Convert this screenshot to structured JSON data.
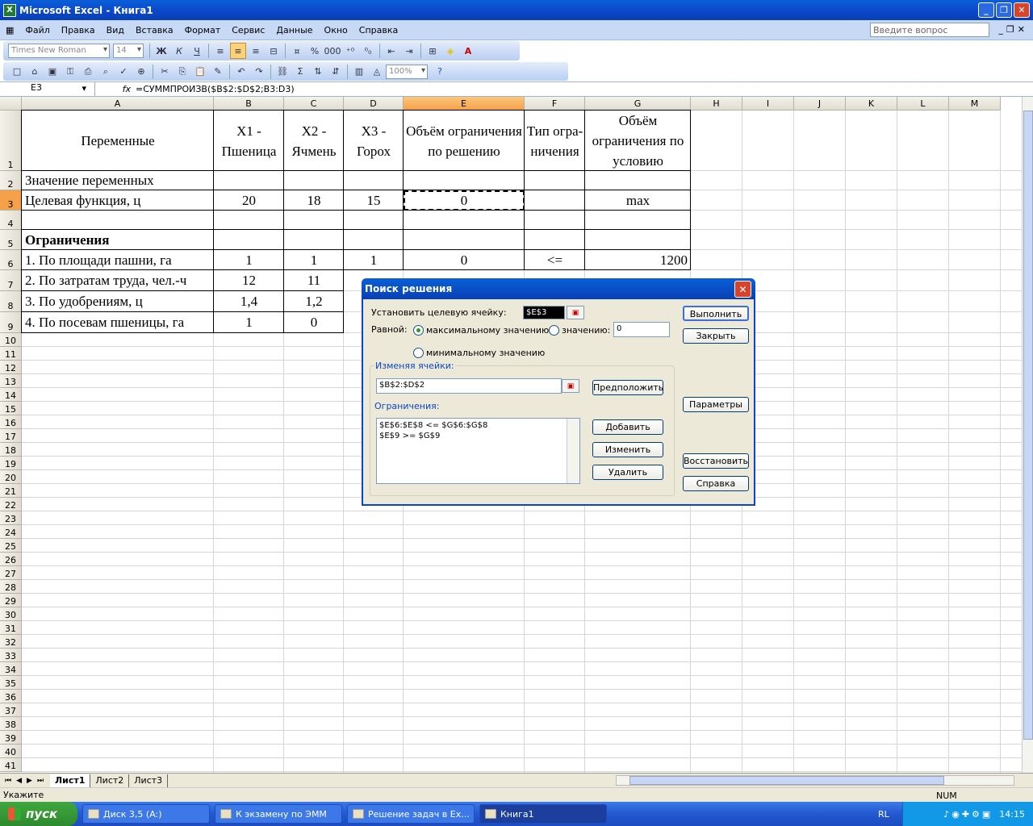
{
  "window": {
    "title": "Microsoft Excel - Книга1",
    "app_icon": "excel-icon"
  },
  "menu": {
    "items": [
      "Файл",
      "Правка",
      "Вид",
      "Вставка",
      "Формат",
      "Сервис",
      "Данные",
      "Окно",
      "Справка"
    ],
    "help_placeholder": "Введите вопрос"
  },
  "toolbar": {
    "font_name": "Times New Roman",
    "font_size": "14",
    "zoom": "100%",
    "bold": "Ж",
    "italic": "К",
    "underline": "Ч"
  },
  "formula_bar": {
    "name_box": "E3",
    "fx": "fx",
    "formula": "=СУММПРОИЗВ($B$2:$D$2;B3:D3)"
  },
  "columns": [
    "A",
    "B",
    "C",
    "D",
    "E",
    "F",
    "G",
    "H",
    "I",
    "J",
    "K",
    "L",
    "M"
  ],
  "selected_cell": "E3",
  "sheet": {
    "header": {
      "a": "Переменные",
      "b": "X1 - Пшеница",
      "c": "X2 - Ячмень",
      "d": "X3 - Горох",
      "e": "Объём ограничения по решению",
      "f": "Тип огра-ничения",
      "g": "Объём ограничения по условию"
    },
    "rows": [
      {
        "a": "Значение переменных",
        "b": "",
        "c": "",
        "d": "",
        "e": "",
        "f": "",
        "g": ""
      },
      {
        "a": "Целевая функция, ц",
        "b": "20",
        "c": "18",
        "d": "15",
        "e": "0",
        "f": "",
        "g": "max"
      },
      {
        "a": "",
        "b": "",
        "c": "",
        "d": "",
        "e": "",
        "f": "",
        "g": ""
      },
      {
        "a": "Ограничения",
        "b": "",
        "c": "",
        "d": "",
        "e": "",
        "f": "",
        "g": ""
      },
      {
        "a": "1. По площади пашни, га",
        "b": "1",
        "c": "1",
        "d": "1",
        "e": "0",
        "f": "<=",
        "g": "1200"
      },
      {
        "a": "2. По затратам труда, чел.-ч",
        "b": "12",
        "c": "11"
      },
      {
        "a": "3. По удобрениям, ц",
        "b": "1,4",
        "c": "1,2"
      },
      {
        "a": "4. По посевам пшеницы, га",
        "b": "1",
        "c": "0"
      }
    ]
  },
  "row_numbers": [
    "1",
    "2",
    "3",
    "4",
    "5",
    "6",
    "7",
    "8",
    "9",
    "10",
    "11",
    "12",
    "13",
    "14",
    "15",
    "16",
    "17",
    "18",
    "19",
    "20",
    "21",
    "22",
    "23",
    "24",
    "25",
    "26",
    "27",
    "28",
    "29",
    "30",
    "31",
    "32",
    "33",
    "34",
    "35",
    "36",
    "37",
    "38",
    "39",
    "40",
    "41"
  ],
  "dialog": {
    "title": "Поиск решения",
    "target_label": "Установить целевую ячейку:",
    "target_value": "$E$3",
    "equal_label": "Равной:",
    "opt_max": "максимальному значению",
    "opt_value": "значению:",
    "value_field": "0",
    "opt_min": "минимальному значению",
    "changing_label": "Изменяя ячейки:",
    "changing_value": "$B$2:$D$2",
    "guess_btn": "Предположить",
    "constraints_label": "Ограничения:",
    "constraints": [
      "$E$6:$E$8 <= $G$6:$G$8",
      "$E$9 >= $G$9"
    ],
    "add_btn": "Добавить",
    "change_btn": "Изменить",
    "delete_btn": "Удалить",
    "run_btn": "Выполнить",
    "close_btn": "Закрыть",
    "params_btn": "Параметры",
    "restore_btn": "Восстановить",
    "help_btn": "Справка",
    "selected_option": "max"
  },
  "sheet_tabs": [
    "Лист1",
    "Лист2",
    "Лист3"
  ],
  "status": {
    "mode": "Укажите",
    "num": "NUM"
  },
  "taskbar": {
    "start": "пуск",
    "tasks": [
      "Диск 3,5 (A:)",
      "К экзамену по ЭММ",
      "Решение задач в Ex...",
      "Книга1"
    ],
    "lang": "RL",
    "clock": "14:15"
  }
}
